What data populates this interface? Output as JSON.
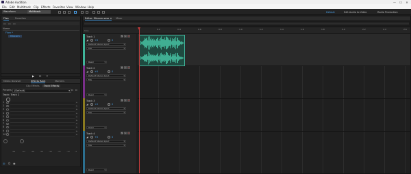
{
  "app": {
    "title": "Adobe Audition"
  },
  "window_controls": {
    "minimize": "—",
    "maximize": "☐",
    "close": "✕"
  },
  "menu": [
    "File",
    "Edit",
    "Multitrack",
    "Clip",
    "Effects",
    "Favorites",
    "View",
    "Window",
    "Help"
  ],
  "toolbar": {
    "view_buttons": [
      {
        "label": "Waveform",
        "active": false
      },
      {
        "label": "Multitrack",
        "active": true
      }
    ],
    "workspaces": [
      {
        "label": "Default",
        "active": true
      },
      {
        "label": "Edit Audio to Video",
        "active": false
      },
      {
        "label": "Radio Production",
        "active": false
      }
    ]
  },
  "files_panel": {
    "tabs": [
      {
        "label": "Files",
        "active": true
      },
      {
        "label": "Favorites",
        "active": false
      }
    ],
    "column_header": "Name",
    "items": [
      "Flow *",
      "Mixcorn"
    ],
    "transport": {
      "play": "▶",
      "loop": "⟳",
      "export": "⇪"
    }
  },
  "effects_panel": {
    "tabs": [
      {
        "label": "Media Browser",
        "active": false
      },
      {
        "label": "Effects Rack",
        "active": true
      },
      {
        "label": "Markers",
        "active": false
      }
    ],
    "subtabs": [
      {
        "label": "Clip Effects",
        "active": false
      },
      {
        "label": "Track Effects",
        "active": true
      }
    ],
    "presets_label": "Presets:",
    "presets_value": "(Default)",
    "track_label": "Track: Track 2",
    "slot_numbers": [
      "1",
      "2",
      "3",
      "4",
      "5",
      "6",
      "7",
      "8",
      "9",
      "10"
    ],
    "meter_ticks": [
      "dB",
      "-57",
      "-48",
      "-39",
      "-30",
      "-21",
      "-12",
      "-3"
    ]
  },
  "editor": {
    "tabs": [
      {
        "label": "Editor: Mixcorn.sesx",
        "active": true
      },
      {
        "label": "Mixer",
        "active": false
      }
    ],
    "close_glyph": "×",
    "timecode_label": "hms",
    "ruler_ticks": [
      "0.2",
      "0.4",
      "0.6",
      "0.8",
      "1.0",
      "1.2",
      "1.4",
      "1.6",
      "1.8",
      "2.0",
      "2.2",
      "2.4",
      "2.6"
    ],
    "tracks": [
      {
        "name": "Track 1",
        "color": "#3fb59a",
        "volume": "+0",
        "pan": "0",
        "input": "Default Stereo Input",
        "mix": "Mix",
        "read": "Read"
      },
      {
        "name": "Track 2",
        "color": "#7a2f8a",
        "volume": "+0",
        "pan": "0",
        "input": "Default Stereo Input",
        "mix": "Mix",
        "read": "Read"
      },
      {
        "name": "Track 3",
        "color": "#8a7a1f",
        "volume": "+0",
        "pan": "0",
        "input": "Default Stereo Input",
        "mix": "Mix",
        "read": "Read"
      },
      {
        "name": "Track 4",
        "color": "#2c6f8f",
        "volume": "+0",
        "pan": "0",
        "input": "Default Stereo Input",
        "mix": "Mix",
        "read": "Read"
      }
    ],
    "msr": [
      "M",
      "S",
      "R"
    ],
    "clip": {
      "track": "Track 1",
      "color": "#3fb59a"
    }
  }
}
